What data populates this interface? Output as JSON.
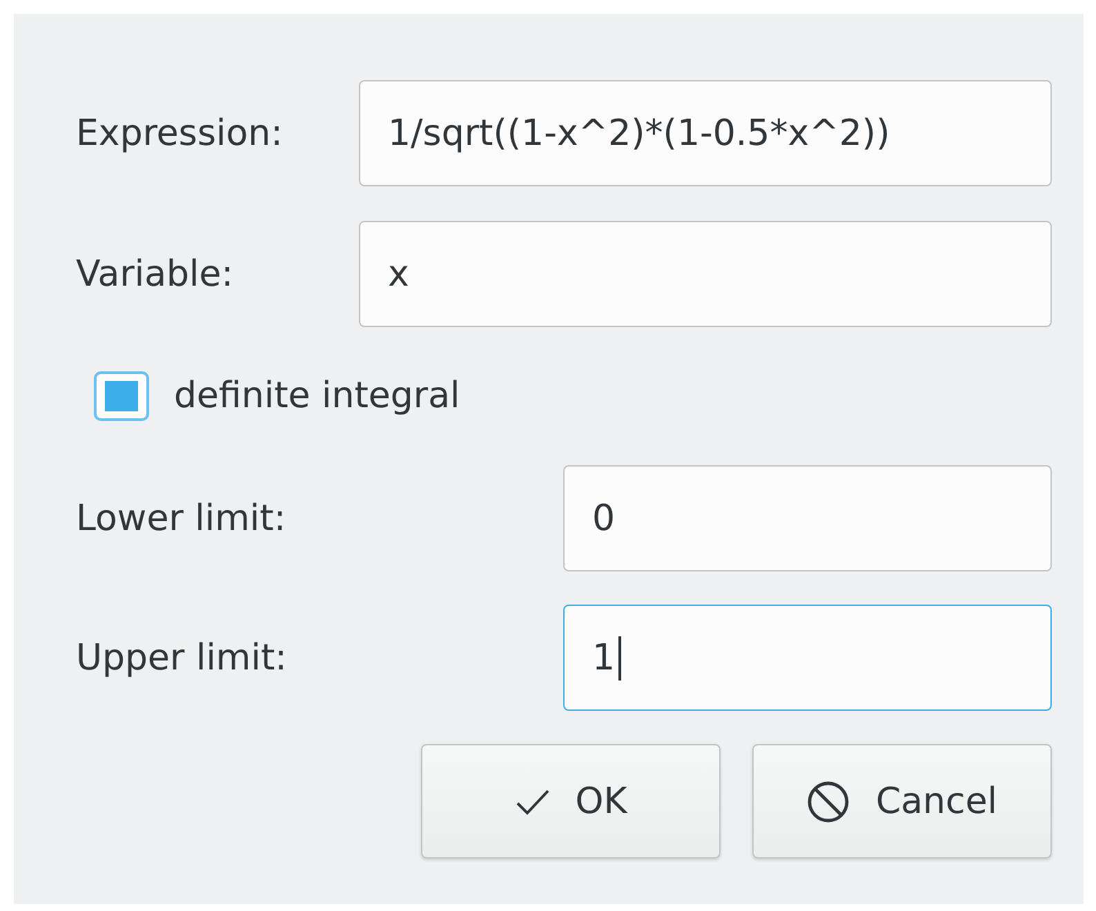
{
  "fields": [
    {
      "label": "Expression:",
      "value": "1/sqrt((1-x^2)*(1-0.5*x^2))",
      "focused": false
    },
    {
      "label": "Variable:",
      "value": "x",
      "focused": false
    }
  ],
  "checkbox": {
    "label": "definite integral",
    "checked": true
  },
  "limits": [
    {
      "label": "Lower limit:",
      "value": "0",
      "focused": false
    },
    {
      "label": "Upper limit:",
      "value": "1",
      "focused": true
    }
  ],
  "buttons": [
    {
      "label": "OK",
      "kind": "ok"
    },
    {
      "label": "Cancel",
      "kind": "cancel"
    }
  ]
}
